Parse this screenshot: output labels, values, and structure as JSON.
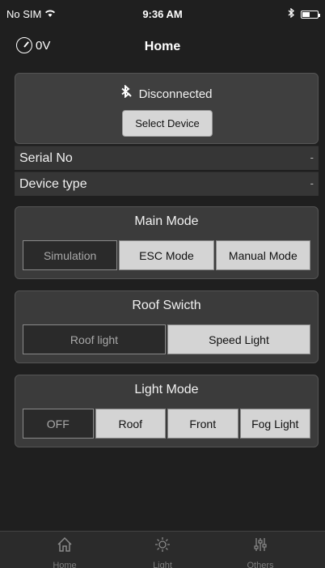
{
  "status_bar": {
    "carrier": "No SIM",
    "time": "9:36 AM"
  },
  "nav": {
    "voltage": "0V",
    "title": "Home"
  },
  "connection": {
    "status": "Disconnected",
    "select_button": "Select Device"
  },
  "info": {
    "serial_label": "Serial No",
    "serial_value": "-",
    "type_label": "Device type",
    "type_value": "-"
  },
  "main_mode": {
    "title": "Main Mode",
    "options": [
      "Simulation",
      "ESC Mode",
      "Manual Mode"
    ],
    "selected": "Simulation"
  },
  "roof_switch": {
    "title": "Roof Swicth",
    "options": [
      "Roof light",
      "Speed Light"
    ],
    "selected": "Roof light"
  },
  "light_mode": {
    "title": "Light Mode",
    "options": [
      "OFF",
      "Roof",
      "Front",
      "Fog Light"
    ],
    "selected": "OFF"
  },
  "tabs": [
    {
      "label": "Home"
    },
    {
      "label": "Light"
    },
    {
      "label": "Others"
    }
  ]
}
